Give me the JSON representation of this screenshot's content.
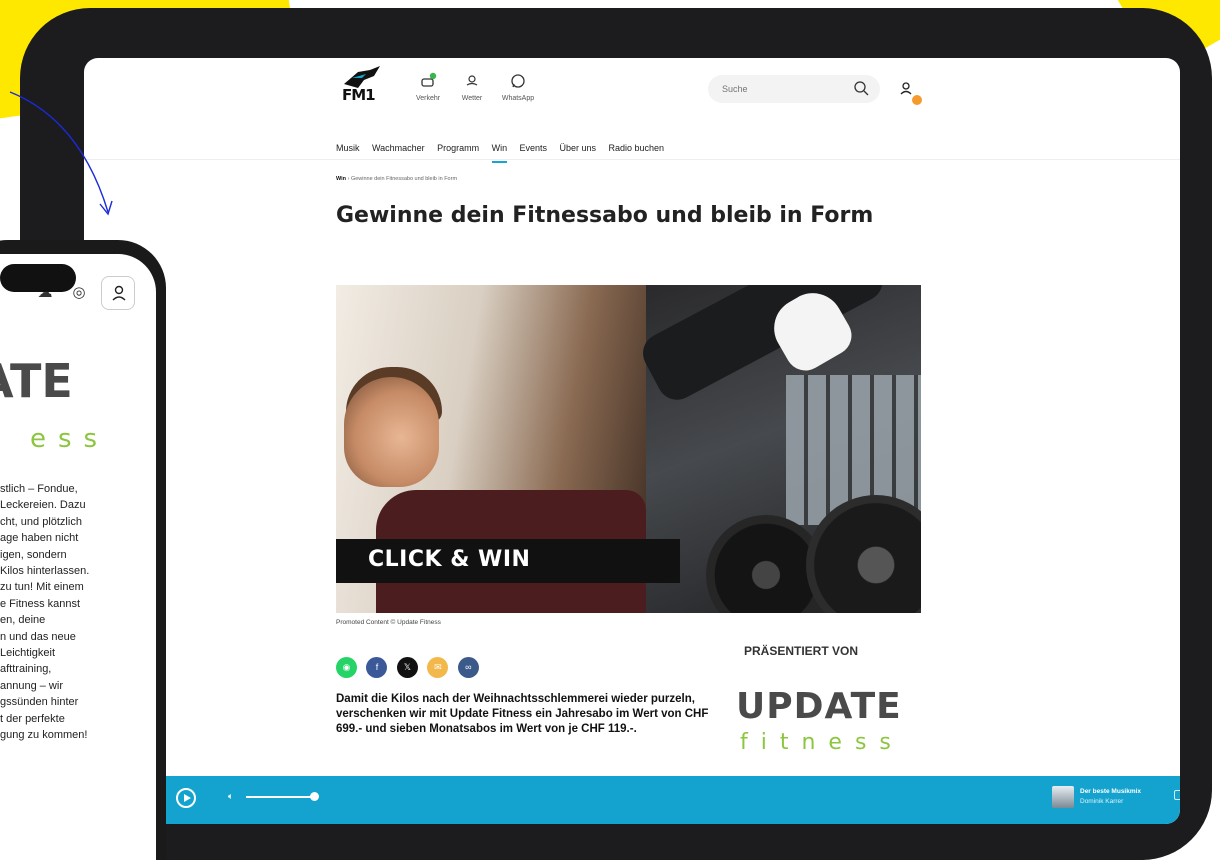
{
  "header": {
    "logo_text": "FM1",
    "quick_links": [
      {
        "label": "Verkehr",
        "icon": "car-icon"
      },
      {
        "label": "Wetter",
        "icon": "weather-icon"
      },
      {
        "label": "WhatsApp",
        "icon": "whatsapp-icon"
      }
    ],
    "search_placeholder": "Suche",
    "nav": [
      "Musik",
      "Wachmacher",
      "Programm",
      "Win",
      "Events",
      "Über uns",
      "Radio buchen"
    ],
    "active_nav": "Win"
  },
  "breadcrumb": {
    "parent": "Win",
    "current": "Gewinne dein Fitnessabo und bleib in Form"
  },
  "article": {
    "title": "Gewinne dein Fitnessabo und bleib in Form",
    "hero_cta": "CLICK & WIN",
    "caption": "Promoted Content © Update Fitness",
    "lead": "Damit die Kilos nach der Weihnachtsschlemmerei wieder purzeln, verschenken wir mit Update Fitness ein Jahresabo im Wert von CHF 699.- und sieben Monatsabos im Wert von je CHF 119.-."
  },
  "share_buttons": [
    {
      "name": "whatsapp",
      "color": "#25d366"
    },
    {
      "name": "facebook",
      "color": "#3b5998"
    },
    {
      "name": "x",
      "color": "#111111"
    },
    {
      "name": "email",
      "color": "#f2b84b"
    },
    {
      "name": "link",
      "color": "#3b5a8a"
    }
  ],
  "sponsor": {
    "heading": "PRÄSENTIERT VON",
    "logo_word": "UPDATE",
    "logo_sub": "fitness",
    "brand_green": "#8cc63f"
  },
  "player": {
    "show_title": "Der beste Musikmix",
    "host": "Dominik Karrer",
    "volume": 0.85,
    "bar_color": "#14a3cf"
  },
  "phone": {
    "logo_partial": "ATE",
    "logo_sub_partial": "ess",
    "body_lines": [
      "stlich – Fondue,",
      "Leckereien. Dazu",
      "cht, und plötzlich",
      "age haben nicht",
      "igen, sondern",
      "Kilos hinterlassen.",
      "zu tun! Mit einem",
      "e Fitness kannst",
      "en, deine",
      "n und das neue",
      "Leichtigkeit",
      "afttraining,",
      "annung – wir",
      "gssünden hinter",
      "t der perfekte",
      "gung zu kommen!"
    ]
  },
  "accent_yellow": "#ffe800"
}
